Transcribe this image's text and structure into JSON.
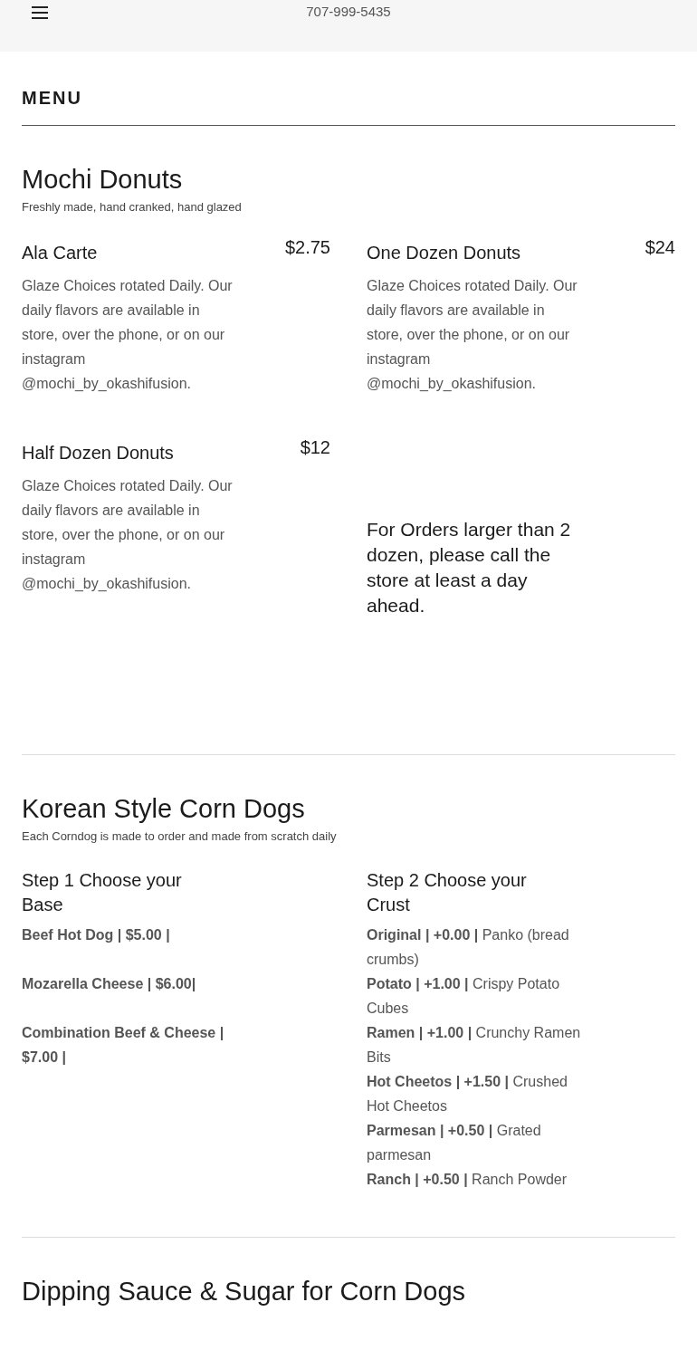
{
  "header": {
    "phone": "707-999-5435"
  },
  "menu_heading": "MENU",
  "sections": [
    {
      "title": "Mochi Donuts",
      "subtitle": "Freshly made, hand cranked, hand glazed",
      "items": [
        {
          "kind": "dish",
          "name": "Ala Carte",
          "price": "$2.75",
          "description": "Glaze Choices rotated Daily. Our daily flavors are available in store, over the phone, or on our instagram @mochi_by_okashifusion."
        },
        {
          "kind": "dish",
          "name": "One Dozen Donuts",
          "price": "$24",
          "description": "Glaze Choices rotated Daily. Our daily flavors are available in store, over the phone, or on our instagram @mochi_by_okashifusion."
        },
        {
          "kind": "dish",
          "name": "Half Dozen Donuts",
          "price": "$12",
          "description": "Glaze Choices rotated Daily. Our daily flavors are available in store, over the phone, or on our instagram @mochi_by_okashifusion."
        },
        {
          "kind": "note",
          "text": "For Orders larger than 2 dozen, please call the store at least a day ahead."
        }
      ]
    },
    {
      "title": "Korean Style Corn Dogs",
      "subtitle": "Each Corndog is made to order and made from scratch daily",
      "items": [
        {
          "kind": "choices",
          "name": "Step 1 Choose your Base",
          "lines": [
            "**Beef Hot Dog | $5.00 |**",
            "**Mozarella Cheese | $6.00|**",
            "**Combination Beef & Cheese | $7.00 |**"
          ]
        },
        {
          "kind": "options",
          "name": "Step 2 Choose your Crust",
          "lines": [
            "**Original | +0.00 |** Panko (bread crumbs)",
            "**Potato | +1.00 |** Crispy Potato Cubes",
            "**Ramen | +1.00 |** Crunchy Ramen Bits",
            "**Hot Cheetos | +1.50 |** Crushed Hot Cheetos",
            "**Parmesan | +0.50 |** Grated parmesan",
            "**Ranch | +0.50 |** Ranch Powder"
          ]
        }
      ]
    },
    {
      "title": "Dipping Sauce & Sugar for Corn Dogs"
    }
  ]
}
